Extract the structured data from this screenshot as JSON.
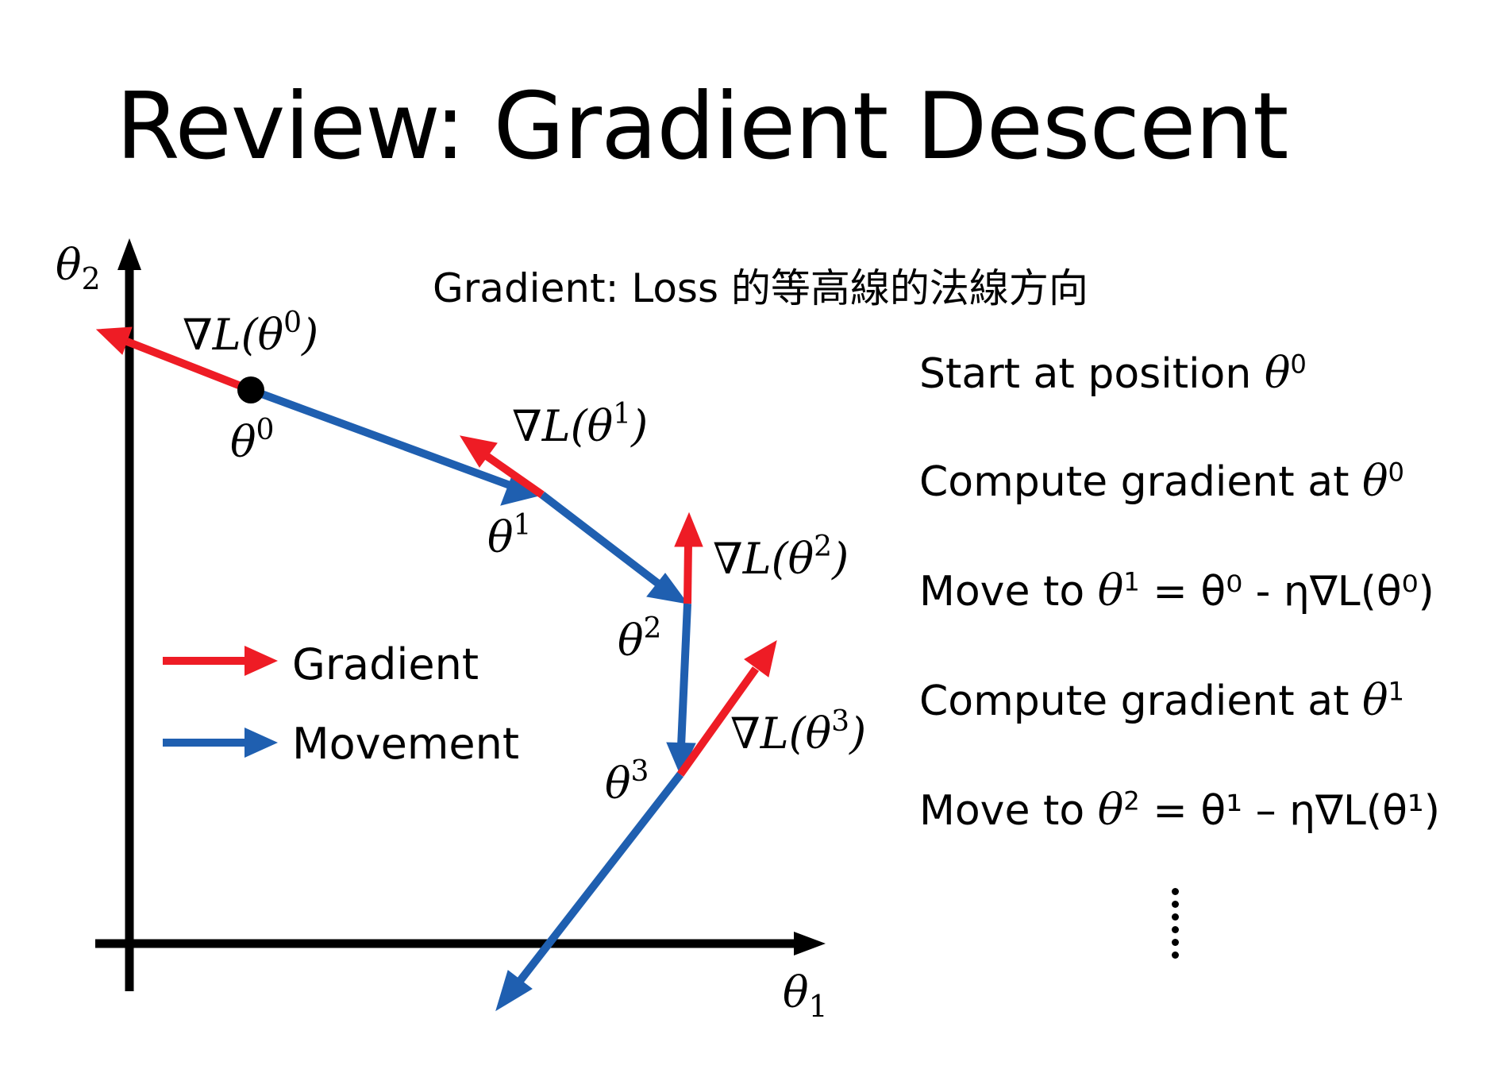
{
  "title": "Review: Gradient Descent",
  "axes": {
    "x_label": "θ",
    "x_sub": "1",
    "y_label": "θ",
    "y_sub": "2"
  },
  "gradient_note": "Gradient: Loss 的等高線的法線方向",
  "points": [
    {
      "name": "θ",
      "sup": "0"
    },
    {
      "name": "θ",
      "sup": "1"
    },
    {
      "name": "θ",
      "sup": "2"
    },
    {
      "name": "θ",
      "sup": "3"
    }
  ],
  "gradient_labels": [
    {
      "prefix": "∇L(θ",
      "sup": "0",
      "suffix": ")"
    },
    {
      "prefix": "∇L(θ",
      "sup": "1",
      "suffix": ")"
    },
    {
      "prefix": "∇L(θ",
      "sup": "2",
      "suffix": ")"
    },
    {
      "prefix": "∇L(θ",
      "sup": "3",
      "suffix": ")"
    }
  ],
  "legend": [
    {
      "label": "Gradient",
      "color": "#ee1c25"
    },
    {
      "label": "Movement",
      "color": "#1f5fb0"
    }
  ],
  "steps": [
    {
      "text": "Start at position ",
      "math": "θ",
      "sup": "0"
    },
    {
      "text": "Compute gradient at ",
      "math": "θ",
      "sup": "0"
    },
    {
      "text": "Move to ",
      "math": "θ",
      "sup": "1",
      "rest": " = θ⁰ - η∇L(θ⁰)"
    },
    {
      "text": "Compute gradient at ",
      "math": "θ",
      "sup": "1"
    },
    {
      "text": "Move to ",
      "math": "θ",
      "sup": "2",
      "rest": " = θ¹ – η∇L(θ¹)"
    }
  ],
  "colors": {
    "gradient": "#ee1c25",
    "movement": "#1f5fb0",
    "axis": "#000000"
  }
}
